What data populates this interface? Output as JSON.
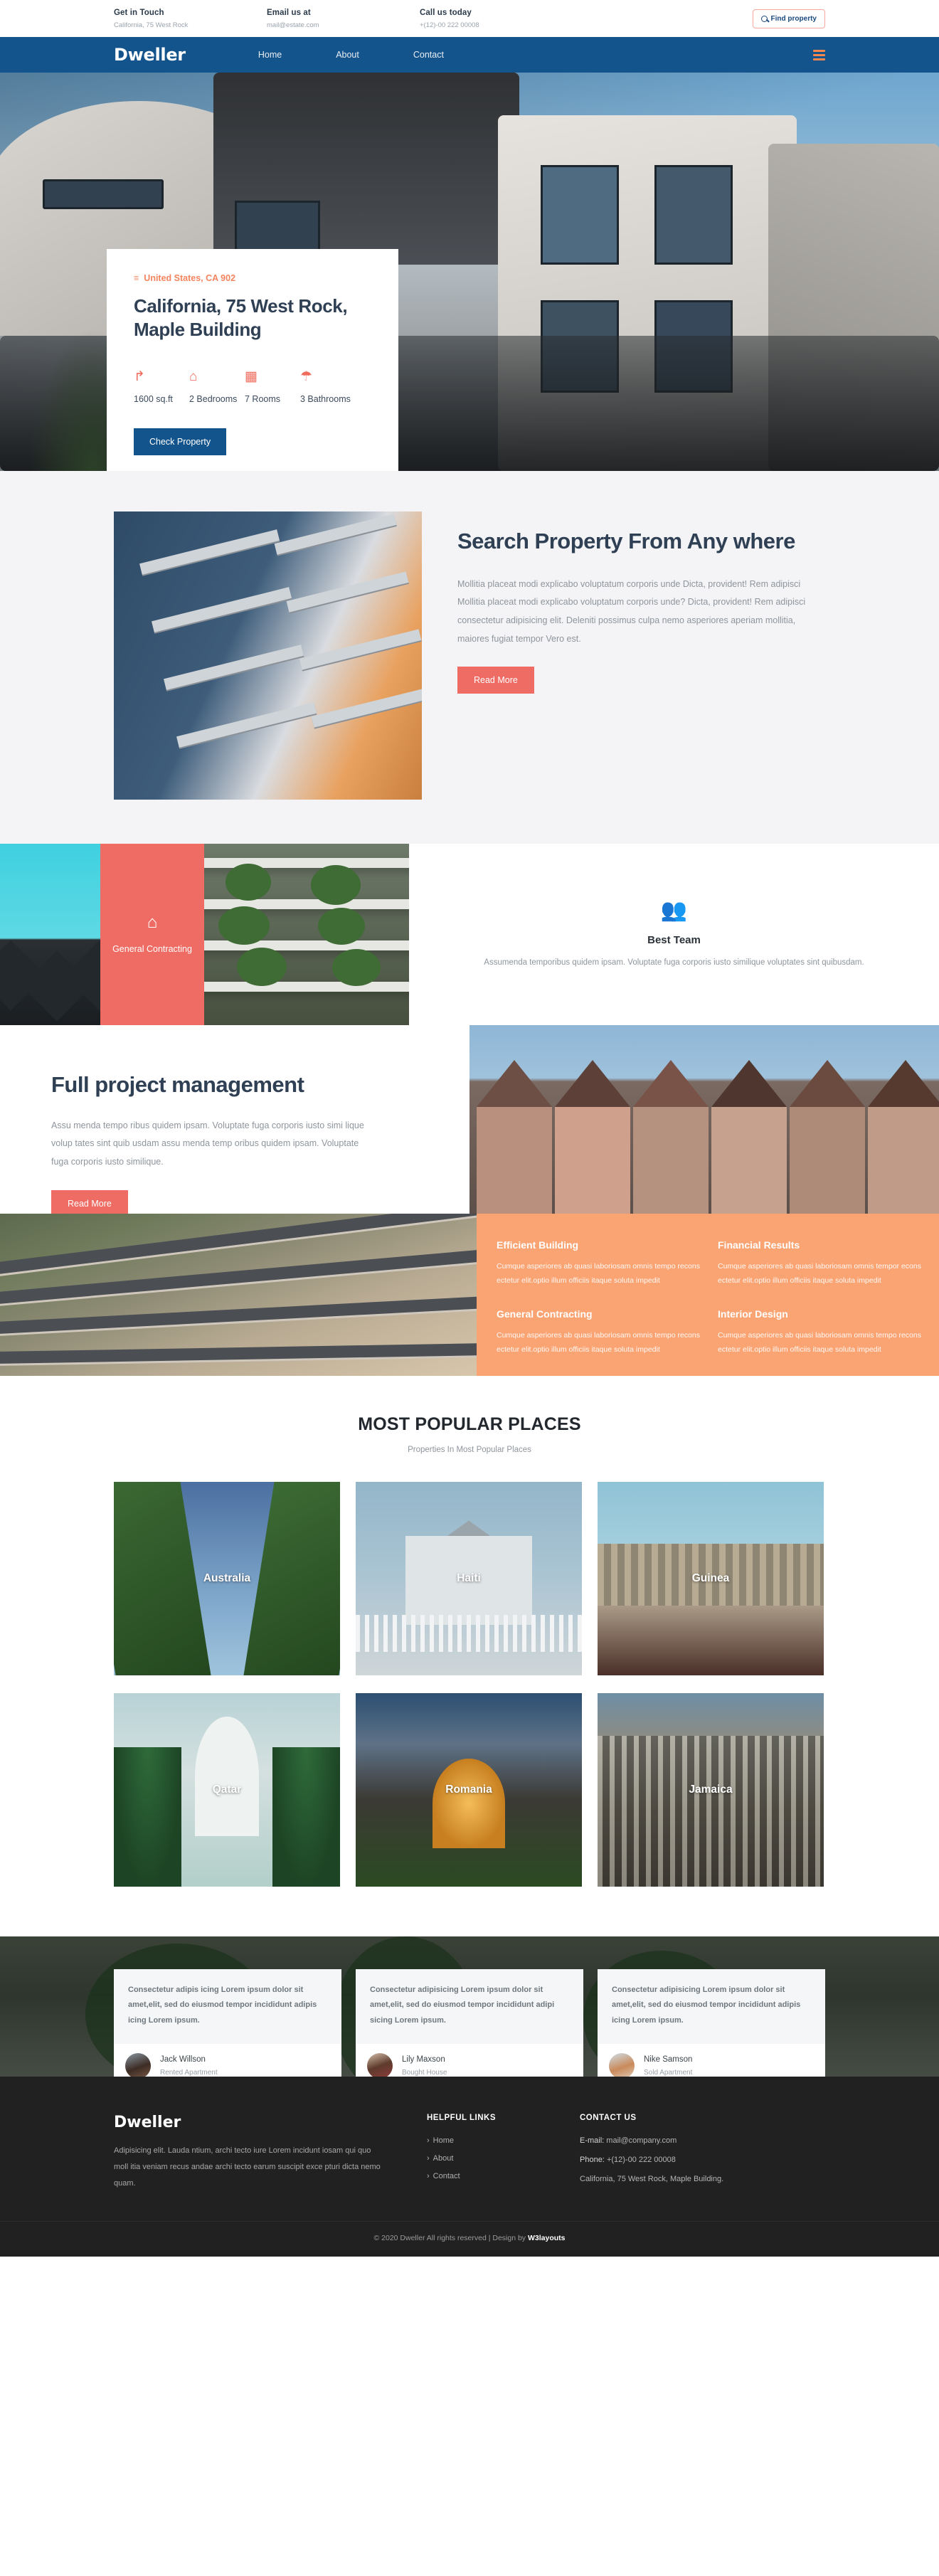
{
  "topbar": {
    "cols": [
      {
        "title": "Get in Touch",
        "sub": "California, 75 West Rock"
      },
      {
        "title": "Email us at",
        "sub": "mail@estate.com"
      },
      {
        "title": "Call us today",
        "sub": "+(12)-00 222 00008"
      }
    ],
    "find_button": "Find property",
    "search_icon": "search-icon"
  },
  "nav": {
    "brand": "Dweller",
    "links": [
      "Home",
      "About",
      "Contact"
    ],
    "menu_icon": "hamburger-menu-icon",
    "bg": "#14548c",
    "accent": "#f4874e"
  },
  "hero": {
    "location": "United States, CA 902",
    "location_icon": "map-pin-icon",
    "title": "California, 75 West Rock, Maple Building",
    "features": [
      {
        "icon": "area-icon",
        "glyph": "↱",
        "label": "1600 sq.ft"
      },
      {
        "icon": "home-icon",
        "glyph": "⌂",
        "label": "2 Bedrooms"
      },
      {
        "icon": "building-icon",
        "glyph": "▦",
        "label": "7 Rooms"
      },
      {
        "icon": "shower-icon",
        "glyph": "☂",
        "label": "3 Bathrooms"
      }
    ],
    "cta": "Check Property"
  },
  "search_section": {
    "heading": "Search Property From Any where",
    "body": "Mollitia placeat modi explicabo voluptatum corporis unde Dicta, provident! Rem adipisci Mollitia placeat modi explicabo voluptatum corporis unde? Dicta, provident! Rem adipisci consectetur adipisicing elit. Deleniti possimus culpa nemo asperiores aperiam mollitia, maiores fugiat tempor Vero est.",
    "cta": "Read More",
    "image": "apartment-balconies-photo"
  },
  "services_band": {
    "card": {
      "icon": "home-icon",
      "label": "General Contracting"
    },
    "best_team": {
      "icon": "team-people-icon",
      "title": "Best Team",
      "body": "Assumenda temporibus quidem ipsam. Voluptate fuga corporis iusto similique voluptates sint quibusdam."
    }
  },
  "project_section": {
    "heading": "Full project management",
    "body": "Assu menda tempo ribus quidem ipsam. Voluptate fuga corporis iusto simi lique volup tates sint quib usdam assu menda temp oribus quidem ipsam. Voluptate fuga corporis iusto similique.",
    "cta": "Read More"
  },
  "features_band": {
    "items": [
      {
        "title": "Efficient Building",
        "body": "Cumque asperiores ab quasi laboriosam omnis tempo recons ectetur elit.optio illum officiis itaque soluta impedit"
      },
      {
        "title": "Financial Results",
        "body": "Cumque asperiores ab quasi laboriosam omnis tempor econs ectetur elit.optio illum officiis itaque soluta impedit"
      },
      {
        "title": "General Contracting",
        "body": "Cumque asperiores ab quasi laboriosam omnis tempo recons ectetur elit.optio illum officiis itaque soluta impedit"
      },
      {
        "title": "Interior Design",
        "body": "Cumque asperiores ab quasi laboriosam omnis tempo recons ectetur elit.optio illum officiis itaque soluta impedit"
      }
    ],
    "bg": "#fba473"
  },
  "popular": {
    "title": "MOST POPULAR PLACES",
    "subtitle": "Properties In Most Popular Places",
    "places": [
      {
        "name": "Australia"
      },
      {
        "name": "Haiti"
      },
      {
        "name": "Guinea"
      },
      {
        "name": "Qatar"
      },
      {
        "name": "Romania"
      },
      {
        "name": "Jamaica"
      }
    ]
  },
  "testimonials": [
    {
      "quote": "Consectetur adipis icing Lorem ipsum dolor sit amet,elit, sed do eiusmod tempor incididunt adipis icing Lorem ipsum.",
      "name": "Jack Willson",
      "role": "Rented Apartment",
      "avatar": "avatar-jack-willson"
    },
    {
      "quote": "Consectetur adipisicing Lorem ipsum dolor sit amet,elit, sed do eiusmod tempor incididunt adipi sicing Lorem ipsum.",
      "name": "Lily Maxson",
      "role": "Bought House",
      "avatar": "avatar-lily-maxson"
    },
    {
      "quote": "Consectetur adipisicing Lorem ipsum dolor sit amet,elit, sed do eiusmod tempor incididunt adipis icing Lorem ipsum.",
      "name": "Nike Samson",
      "role": "Sold Apartment",
      "avatar": "avatar-nike-samson"
    }
  ],
  "footer": {
    "brand": "Dweller",
    "desc": "Adipisicing elit. Lauda ntium, archi tecto iure Lorem incidunt iosam qui quo moll itia veniam recus andae archi tecto earum suscipit exce pturi dicta nemo quam.",
    "links_heading": "HELPFUL LINKS",
    "links": [
      "Home",
      "About",
      "Contact"
    ],
    "contact_heading": "CONTACT US",
    "email_label": "E-mail:",
    "email": "mail@company.com",
    "phone_label": "Phone:",
    "phone": "+(12)-00 222 00008",
    "address": "California, 75 West Rock, Maple Building.",
    "copyright_pre": "© 2020 Dweller All rights reserved | Design by ",
    "copyright_brand": "W3layouts"
  }
}
